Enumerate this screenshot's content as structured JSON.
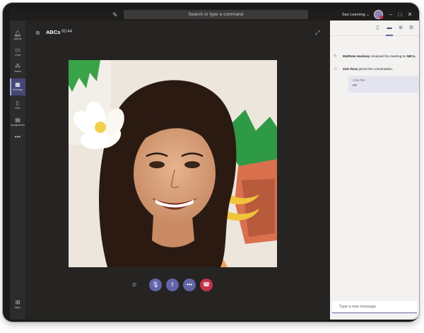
{
  "app": {
    "search_placeholder": "Search or type a command",
    "org_name": "Sao Learning ⌄",
    "accent_color": "#6264a7",
    "hangup_color": "#c4314b"
  },
  "rail": {
    "items": [
      {
        "label": "Activity",
        "icon": "bell-icon"
      },
      {
        "label": "Chat",
        "icon": "chat-icon"
      },
      {
        "label": "Teams",
        "icon": "teams-icon"
      },
      {
        "label": "Meetings",
        "icon": "calendar-icon"
      },
      {
        "label": "Files",
        "icon": "file-icon"
      },
      {
        "label": "Assignments",
        "icon": "assignments-icon"
      },
      {
        "label": "Apps",
        "icon": "apps-icon"
      }
    ]
  },
  "meeting": {
    "title": "ABCs",
    "timer": "00:44"
  },
  "chat": {
    "messages": [
      {
        "actor": "Matthew Hackney",
        "text": " renamed the meeting to ",
        "target": "ABCs."
      },
      {
        "actor": "Zain Raza",
        "text": " joined the conversation.",
        "target": ""
      }
    ],
    "bubble": {
      "time": "2:45 PM",
      "text": "Hi!"
    },
    "composer_placeholder": "Type a new message"
  }
}
